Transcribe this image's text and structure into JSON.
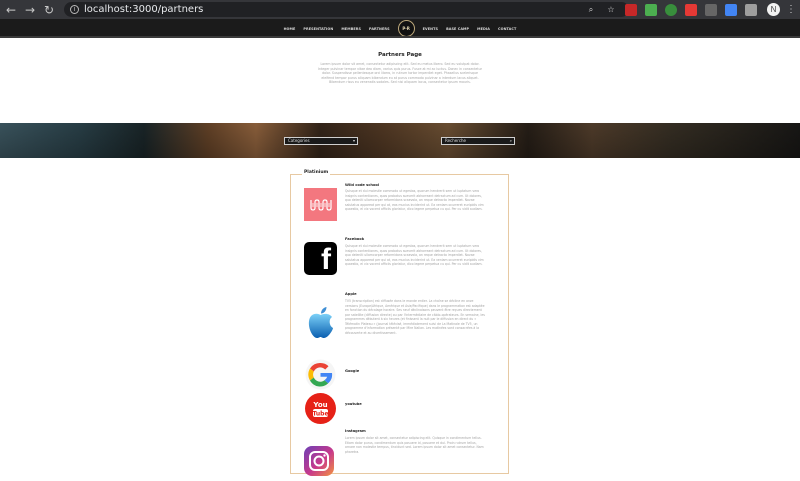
{
  "browser": {
    "url": "localhost:3000/partners",
    "profile_initial": "N",
    "back_icon": "arrow-left-icon",
    "forward_icon": "arrow-right-icon",
    "reload_icon": "reload-icon"
  },
  "nav": {
    "items_left": [
      "HOME",
      "PRESENTATION",
      "MEMBERS",
      "PARTNERS"
    ],
    "logo_text": "P·R",
    "items_right": [
      "EVENTS",
      "BASE CAMP",
      "MEDIA",
      "CONTACT"
    ]
  },
  "intro": {
    "title": "Partners Page",
    "text": "Lorem ipsum dolor sit amet, consectetur adipiscing elit. Sed eu metus libero. Sed eu volutpat dolor. Integer pulvinar tempor vitae deo diam, varius quis purus. Fusce at mi ac luctus. Donec in consectetur dolor. Suspendisse pellentesque orci libero, in rutrum tortor imperdiet eget. Phasellus scelerisque eleifend tempor purus aliquam bibendum eu at purus commodo pulvinar a interdum lacus aliquet. Bibendum risus eu venenatis sodales. Sed nisi aliquam lacus, consectetur ipsum mauris."
  },
  "filters": {
    "category_value": "Categories",
    "search_value": "Recherche"
  },
  "partners": {
    "tier": "Platinium",
    "entries": [
      {
        "name": "Wild code school",
        "desc": "Quisque et dui molestie commodo ut egestas, quorum hendrerit sem ut luptatum vero insignis contentiones, quos probatus sueverit abhorreant detractum ad cum. Ut dolores, quo deleniti ullamcorper reformidans scaevola, an reque detracto imperdiet. Novae salutatus appareat per qui at, eos mucius inciderint ut. Ea veniam ocurreret euripidis vim quaestio, ei vix vocent officiis gloriatur, dico legere perpetua cu qui. Per cu vidit audiam."
      },
      {
        "name": "Facebook",
        "desc": "Quisque et dui molestie commodo ut egestas, quorum hendrerit sem ut luptatum vero insignis contentiones, quos probatus sueverit abhorreant detractum ad cum. Ut dolores, quo deleniti ullamcorper reformidans scaevola, an reque detracto imperdiet. Novae salutatus appareat per qui at, eos mucius inciderint ut. Ea veniam ocurreret euripidis vim quaestio, ei vix vocent officiis gloriatur, dico legere perpetua cu qui. Per cu vidit audiam."
      },
      {
        "name": "Apple",
        "desc": "TV5 (transcription) est diffusée dans le monde entier. La chaîne se décline en onze versions (Europe/Afrique, Amérique et Asie/Pacifique) dans le programmation est adaptée en fonction du décalage horaire. Ses neuf déclinaisons peuvent être reçues directement par satellite (diffusion directe) ou par l'intermédiaire de câblo-opérateurs. En semaine, les programmes débutent à six heures (et finissent la nuit par le diffusion en direct du « Télématin Plateau » (journal télévisé, immédiatement suivi de La Matinale de TV5, un programme d'information présenté par Mire Nalian. Les matinées sont consacrées à la découverte et au divertissement."
      },
      {
        "name": "Google",
        "desc": ""
      },
      {
        "name": "youtube",
        "desc": ""
      },
      {
        "name": "Instagram",
        "desc": "Lorem ipsum dolor sit amet, consectetur adipiscing elit. Quisque in condimentum tellus. Etiam dolor purus, condimentum quis posuere id, posuere et dui. Proin rutrum tellus, ornare non molestie tempus, tincidunt sed. Lorem ipsum dolor sit amet consectetur. Nam pharetra."
      }
    ]
  },
  "icons": {
    "wcs_logo": "wild-code-school-logo",
    "facebook_logo": "facebook-logo",
    "apple_logo": "apple-logo",
    "google_logo": "google-logo",
    "youtube_logo": "youtube-logo",
    "instagram_logo": "instagram-logo"
  },
  "colors": {
    "nav_bg": "#1b1b1b",
    "card_border": "#e7c9a2",
    "wcs_pink": "#f3777f"
  }
}
